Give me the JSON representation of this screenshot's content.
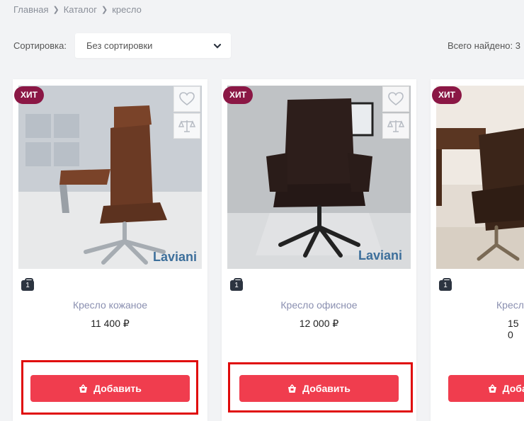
{
  "breadcrumb": {
    "items": [
      "Главная",
      "Каталог",
      "кресло"
    ]
  },
  "sort": {
    "label": "Сортировка:",
    "value": "Без сортировки"
  },
  "total": "Всего найдено: 3",
  "products": [
    {
      "badge": "ХИТ",
      "qty": "1",
      "name": "Кресло кожаное",
      "price": "11 400 ₽",
      "button": "Добавить",
      "brand": "Laviani"
    },
    {
      "badge": "ХИТ",
      "qty": "1",
      "name": "Кресло офисное",
      "price": "12 000 ₽",
      "button": "Добавить",
      "brand": "Laviani"
    },
    {
      "badge": "ХИТ",
      "qty": "1",
      "name": "Кресло",
      "price": "15 0",
      "button": "Добавить"
    }
  ],
  "colors": {
    "accent": "#f03d4e",
    "badge": "#8b1745",
    "highlight": "#e00b0b"
  }
}
